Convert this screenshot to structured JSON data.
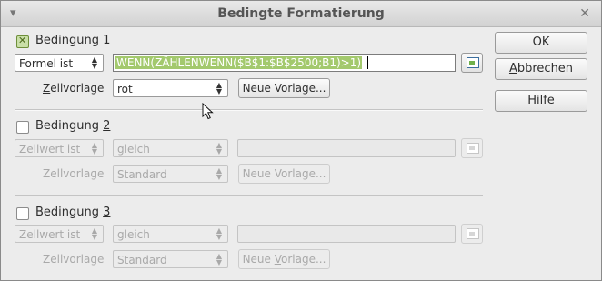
{
  "window": {
    "title": "Bedingte Formatierung"
  },
  "condition1": {
    "label": "Bedingung",
    "num": "1",
    "checked": true,
    "type": "Formel ist",
    "formula": "WENN(ZÄHLENWENN($B$1:$B$2500;B1)>1)",
    "style_label_pre": "Z",
    "style_label_post": "ellvorlage",
    "style": "rot",
    "new_style": "Neue Vorlage..."
  },
  "condition2": {
    "label": "Bedingung",
    "num": "2",
    "checked": false,
    "type": "Zellwert ist",
    "operator": "gleich",
    "value": "",
    "style_label": "Zellvorlage",
    "style": "Standard",
    "new_style": "Neue Vorlage..."
  },
  "condition3": {
    "label": "Bedingung",
    "num": "3",
    "checked": false,
    "type": "Zellwert ist",
    "operator": "gleich",
    "value": "",
    "style_label": "Zellvorlage",
    "style": "Standard",
    "new_style_pre": "Neue ",
    "new_style_mn": "V",
    "new_style_post": "orlage..."
  },
  "buttons": {
    "ok": "OK",
    "cancel_mn": "A",
    "cancel_rest": "bbrechen",
    "help_mn": "H",
    "help_rest": "ilfe"
  },
  "icons": {
    "menu": "chevron-down-icon",
    "close": "close-icon",
    "spin": "spin-arrows-icon",
    "picker": "shrink-select-icon",
    "cursor": "mouse-pointer-icon"
  }
}
